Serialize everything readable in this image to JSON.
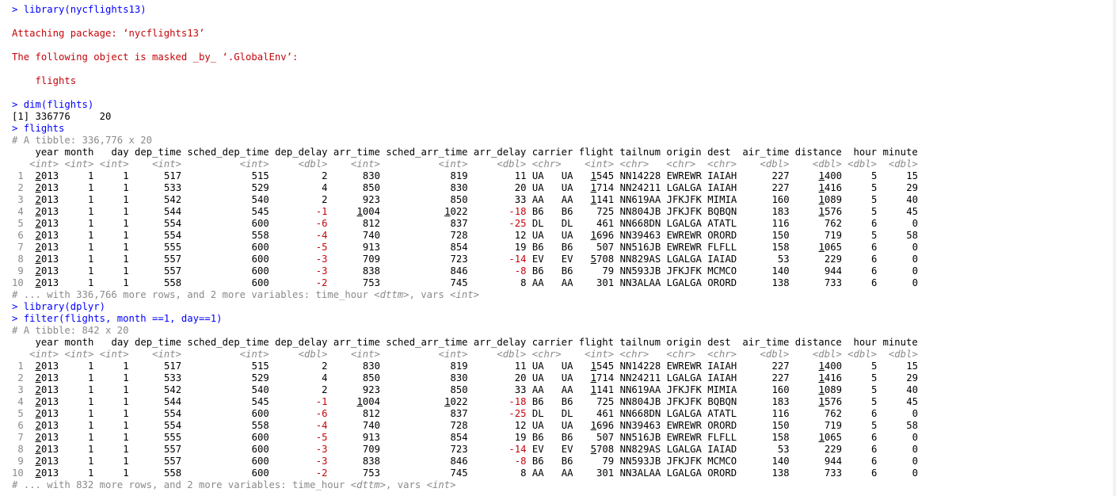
{
  "console": {
    "commands": [
      "> library(nycflights13)",
      "> dim(flights)",
      "> flights",
      "> library(dplyr)",
      "> filter(flights, month ==1, day==1)"
    ],
    "messages": {
      "attaching": "Attaching package: ‘nycflights13’",
      "masked": "The following object is masked _by_ ‘.GlobalEnv’:",
      "object": "    flights"
    },
    "dim_output": "[1] 336776     20",
    "tables": [
      {
        "tibble_line": "# A tibble: 336,776 x 20",
        "footer_prefix": "# ... with 336,766 more rows, and 2 more variables: time_hour ",
        "footer_type1": "<dttm>",
        "footer_middle": ", vars ",
        "footer_type2": "<int>"
      },
      {
        "tibble_line": "# A tibble: 842 x 20",
        "footer_prefix": "# ... with 832 more rows, and 2 more variables: time_hour ",
        "footer_type1": "<dttm>",
        "footer_middle": ", vars ",
        "footer_type2": "<int>"
      }
    ],
    "columns": [
      "year",
      "month",
      "day",
      "dep_time",
      "sched_dep_time",
      "dep_delay",
      "arr_time",
      "sched_arr_time",
      "arr_delay",
      "carrier",
      "flight",
      "tailnum",
      "origin",
      "dest",
      "air_time",
      "distance",
      "hour",
      "minute"
    ],
    "types": [
      "<int>",
      "<int>",
      "<int>",
      "<int>",
      "<int>",
      "<dbl>",
      "<int>",
      "<int>",
      "<dbl>",
      "<chr>",
      "<int>",
      "<chr>",
      "<chr>",
      "<chr>",
      "<dbl>",
      "<dbl>",
      "<dbl>",
      "<dbl>"
    ],
    "rows": [
      [
        "1",
        "2013",
        "1",
        "1",
        "517",
        "515",
        "2",
        "830",
        "819",
        "11",
        "UA",
        "1545",
        "N14228",
        "EWR",
        "IAH",
        "227",
        "1400",
        "5",
        "15"
      ],
      [
        "2",
        "2013",
        "1",
        "1",
        "533",
        "529",
        "4",
        "850",
        "830",
        "20",
        "UA",
        "1714",
        "N24211",
        "LGA",
        "IAH",
        "227",
        "1416",
        "5",
        "29"
      ],
      [
        "3",
        "2013",
        "1",
        "1",
        "542",
        "540",
        "2",
        "923",
        "850",
        "33",
        "AA",
        "1141",
        "N619AA",
        "JFK",
        "MIA",
        "160",
        "1089",
        "5",
        "40"
      ],
      [
        "4",
        "2013",
        "1",
        "1",
        "544",
        "545",
        "-1",
        "1004",
        "1022",
        "-18",
        "B6",
        "725",
        "N804JB",
        "JFK",
        "BQN",
        "183",
        "1576",
        "5",
        "45"
      ],
      [
        "5",
        "2013",
        "1",
        "1",
        "554",
        "600",
        "-6",
        "812",
        "837",
        "-25",
        "DL",
        "461",
        "N668DN",
        "LGA",
        "ATL",
        "116",
        "762",
        "6",
        "0"
      ],
      [
        "6",
        "2013",
        "1",
        "1",
        "554",
        "558",
        "-4",
        "740",
        "728",
        "12",
        "UA",
        "1696",
        "N39463",
        "EWR",
        "ORD",
        "150",
        "719",
        "5",
        "58"
      ],
      [
        "7",
        "2013",
        "1",
        "1",
        "555",
        "600",
        "-5",
        "913",
        "854",
        "19",
        "B6",
        "507",
        "N516JB",
        "EWR",
        "FLL",
        "158",
        "1065",
        "6",
        "0"
      ],
      [
        "8",
        "2013",
        "1",
        "1",
        "557",
        "600",
        "-3",
        "709",
        "723",
        "-14",
        "EV",
        "5708",
        "N829AS",
        "LGA",
        "IAD",
        "53",
        "229",
        "6",
        "0"
      ],
      [
        "9",
        "2013",
        "1",
        "1",
        "557",
        "600",
        "-3",
        "838",
        "846",
        "-8",
        "B6",
        "79",
        "N593JB",
        "JFK",
        "MCO",
        "140",
        "944",
        "6",
        "0"
      ],
      [
        "10",
        "2013",
        "1",
        "1",
        "558",
        "600",
        "-2",
        "753",
        "745",
        "8",
        "AA",
        "301",
        "N3ALAA",
        "LGA",
        "ORD",
        "138",
        "733",
        "6",
        "0"
      ]
    ]
  }
}
